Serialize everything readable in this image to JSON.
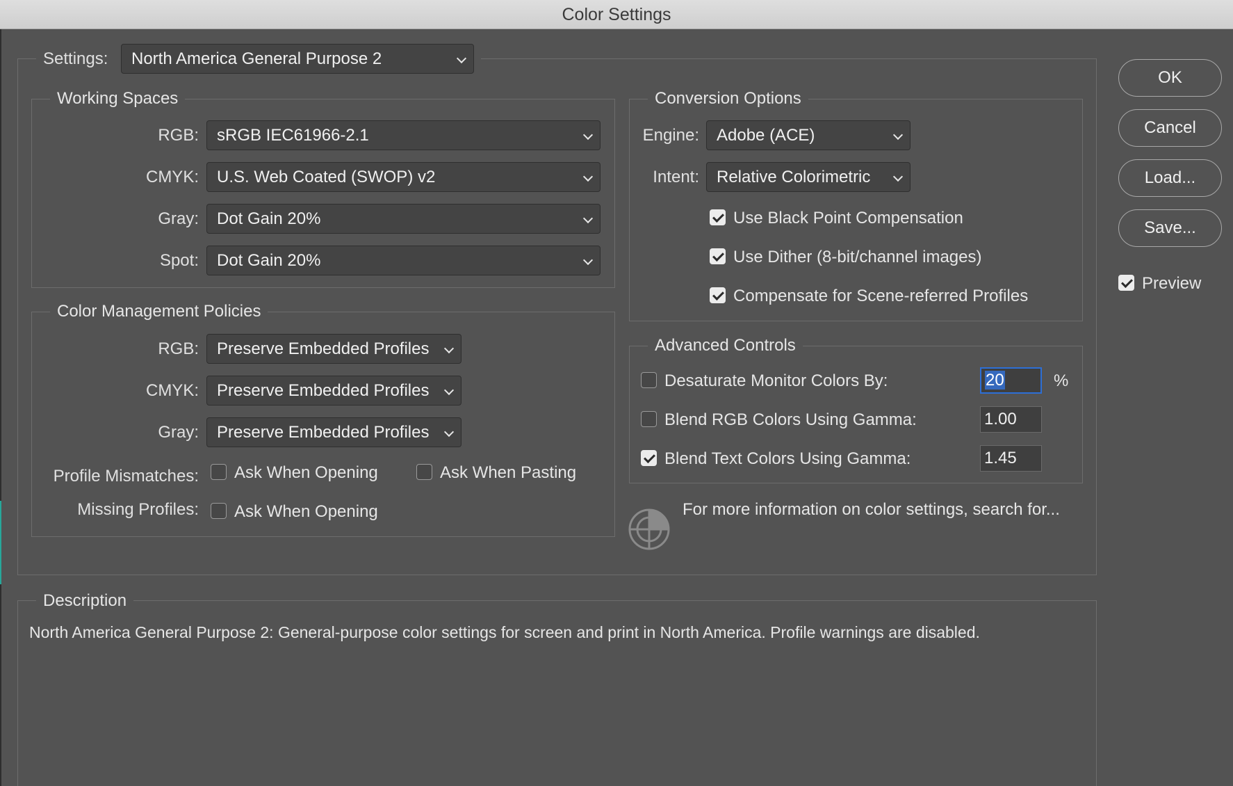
{
  "window": {
    "title": "Color Settings"
  },
  "settings": {
    "label": "Settings:",
    "value": "North America General Purpose 2"
  },
  "working_spaces": {
    "title": "Working Spaces",
    "rgb": {
      "label": "RGB:",
      "value": "sRGB IEC61966-2.1"
    },
    "cmyk": {
      "label": "CMYK:",
      "value": "U.S. Web Coated (SWOP) v2"
    },
    "gray": {
      "label": "Gray:",
      "value": "Dot Gain 20%"
    },
    "spot": {
      "label": "Spot:",
      "value": "Dot Gain 20%"
    }
  },
  "policies": {
    "title": "Color Management Policies",
    "rgb": {
      "label": "RGB:",
      "value": "Preserve Embedded Profiles"
    },
    "cmyk": {
      "label": "CMYK:",
      "value": "Preserve Embedded Profiles"
    },
    "gray": {
      "label": "Gray:",
      "value": "Preserve Embedded Profiles"
    },
    "mismatches": {
      "label": "Profile Mismatches:",
      "ask_opening": "Ask When Opening",
      "ask_opening_checked": false,
      "ask_pasting": "Ask When Pasting",
      "ask_pasting_checked": false
    },
    "missing": {
      "label": "Missing Profiles:",
      "ask_opening": "Ask When Opening",
      "ask_opening_checked": false
    }
  },
  "conversion": {
    "title": "Conversion Options",
    "engine": {
      "label": "Engine:",
      "value": "Adobe (ACE)"
    },
    "intent": {
      "label": "Intent:",
      "value": "Relative Colorimetric"
    },
    "black_point": {
      "label": "Use Black Point Compensation",
      "checked": true
    },
    "dither": {
      "label": "Use Dither (8-bit/channel images)",
      "checked": true
    },
    "scene_referred": {
      "label": "Compensate for Scene-referred Profiles",
      "checked": true
    }
  },
  "advanced": {
    "title": "Advanced Controls",
    "desaturate": {
      "label": "Desaturate Monitor Colors By:",
      "value": "20",
      "unit": "%",
      "checked": false
    },
    "blend_rgb": {
      "label": "Blend RGB Colors Using Gamma:",
      "value": "1.00",
      "checked": false
    },
    "blend_text": {
      "label": "Blend Text Colors Using Gamma:",
      "value": "1.45",
      "checked": true
    }
  },
  "info": {
    "text": "For more information on color settings, search for...",
    "icon": "color-target-icon"
  },
  "description": {
    "title": "Description",
    "text": "North America General Purpose 2:  General-purpose color settings for screen and print in North America. Profile warnings are disabled."
  },
  "buttons": {
    "ok": "OK",
    "cancel": "Cancel",
    "load": "Load...",
    "save": "Save..."
  },
  "preview": {
    "label": "Preview",
    "checked": true
  },
  "colors": {
    "background": "#535353",
    "focus": "#2d6fd6",
    "selection": "#3569bd"
  }
}
